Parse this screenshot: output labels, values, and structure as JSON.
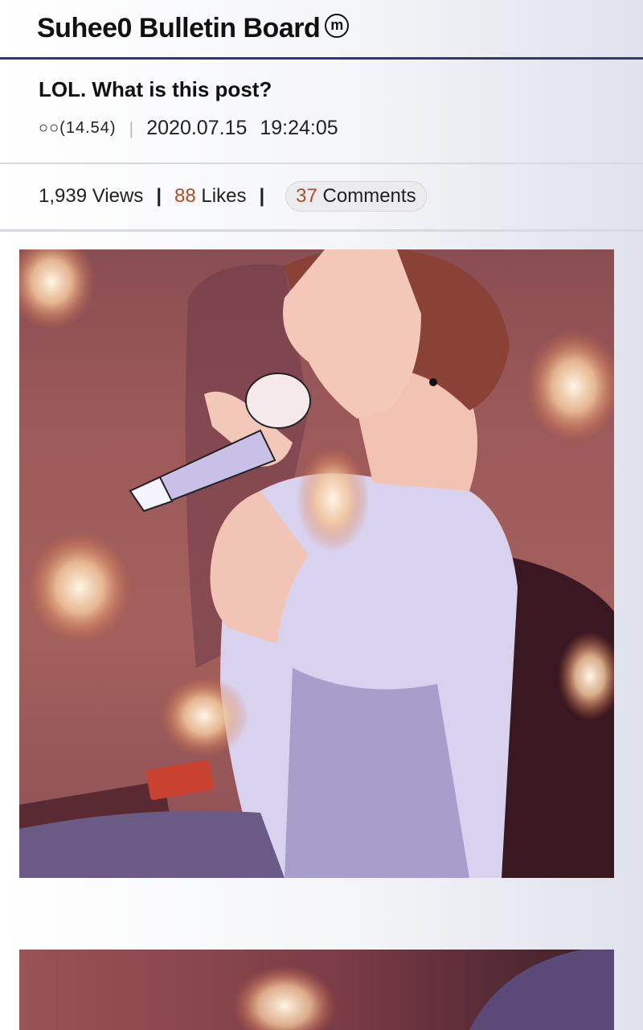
{
  "header": {
    "title": "Suhee0 Bulletin Board",
    "badge": "m"
  },
  "post": {
    "title": "LOL. What is this post?",
    "author": "○○(14.54)",
    "date": "2020.07.15",
    "time": "19:24:05"
  },
  "stats": {
    "views_count": "1,939",
    "views_label": "Views",
    "likes_count": "88",
    "likes_label": "Likes",
    "comments_count": "37",
    "comments_label": "Comments",
    "accent_color": "#b34a26"
  },
  "colors": {
    "header_rule": "#2a3a7a"
  }
}
